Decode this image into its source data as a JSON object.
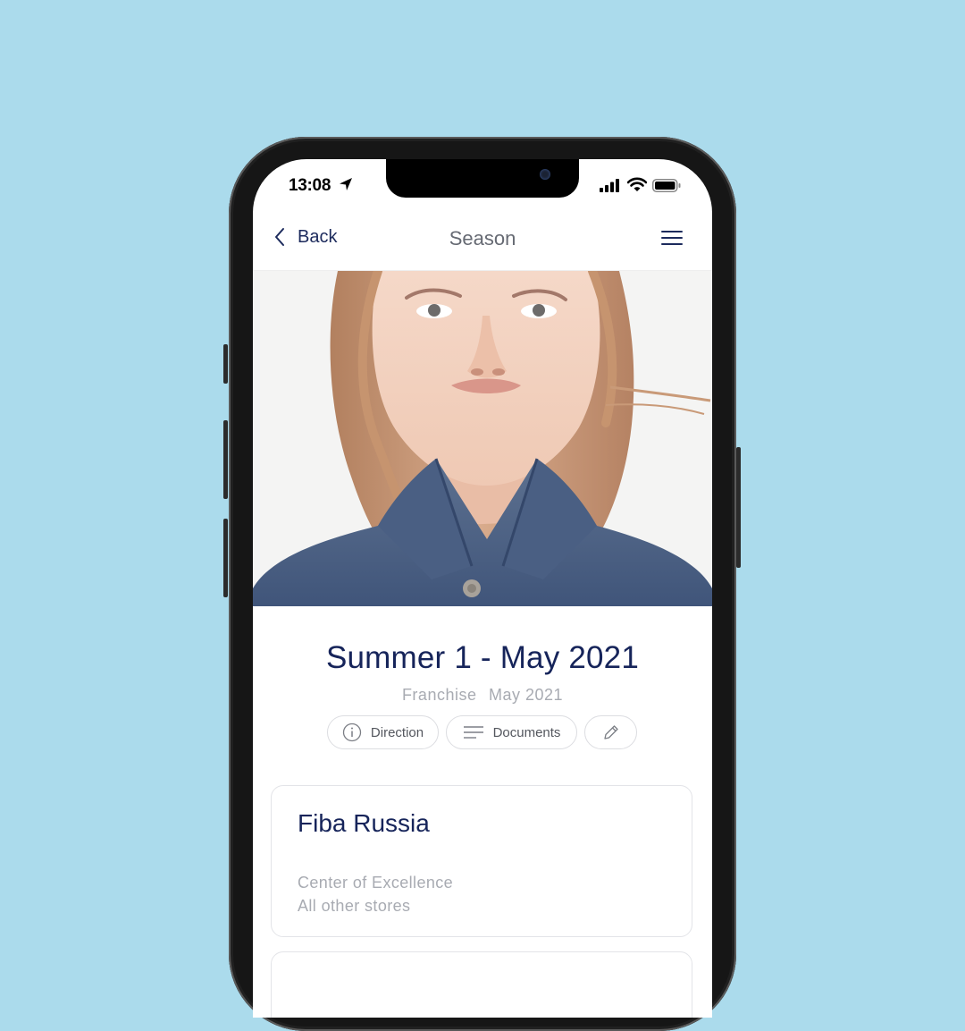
{
  "status_bar": {
    "time": "13:08"
  },
  "navbar": {
    "back_label": "Back",
    "title": "Season"
  },
  "season": {
    "title": "Summer 1 - May 2021",
    "type": "Franchise",
    "date": "May 2021"
  },
  "actions": {
    "direction_label": "Direction",
    "documents_label": "Documents"
  },
  "cards": [
    {
      "title": "Fiba Russia",
      "lines": [
        "Center of Excellence",
        "All other stores"
      ]
    }
  ],
  "colors": {
    "background": "#abdbec",
    "accent": "#16245a",
    "muted": "#a8abb2"
  },
  "icons": [
    "location-arrow-icon",
    "signal-icon",
    "wifi-icon",
    "battery-icon",
    "chevron-left-icon",
    "hamburger-menu-icon",
    "info-icon",
    "documents-icon",
    "pencil-icon"
  ]
}
